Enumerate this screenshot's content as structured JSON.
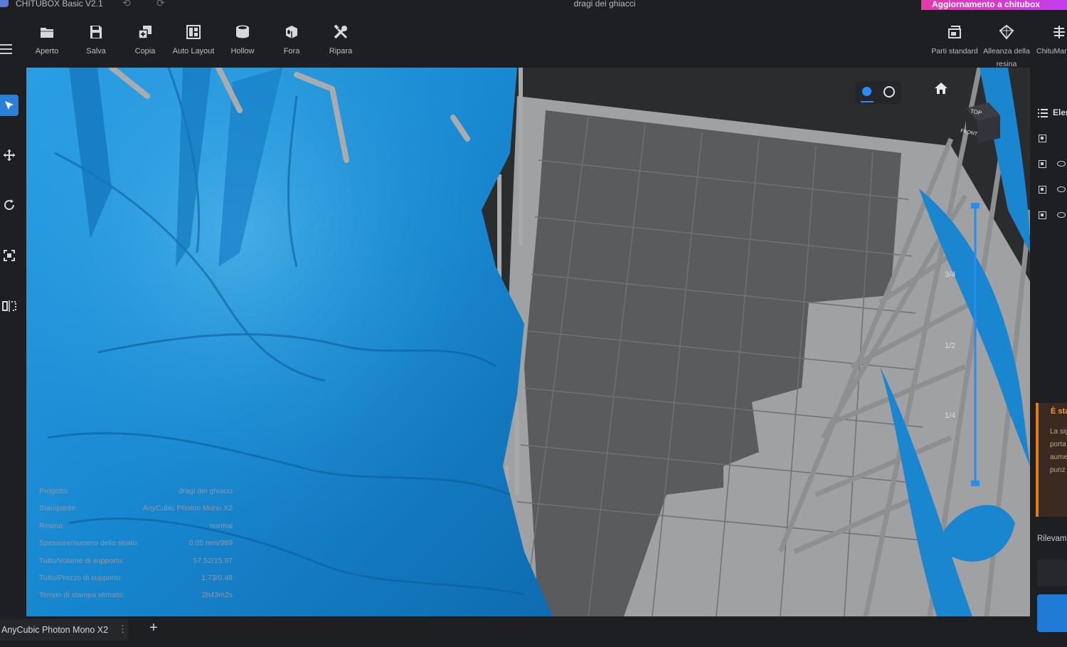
{
  "titlebar": {
    "app_title": "CHITUBOX Basic V2.1",
    "document_title": "dragi dei ghiacci",
    "update_banner": "Aggiornamento a chitubox"
  },
  "toolbar": {
    "tools": [
      {
        "label": "Aperto",
        "icon": "folder-icon"
      },
      {
        "label": "Salva",
        "icon": "save-icon"
      },
      {
        "label": "Copia",
        "icon": "copy-icon"
      },
      {
        "label": "Auto Layout",
        "icon": "auto-layout-icon"
      },
      {
        "label": "Hollow",
        "icon": "hollow-icon"
      },
      {
        "label": "Fora",
        "icon": "drill-icon"
      },
      {
        "label": "Ripara",
        "icon": "repair-icon"
      }
    ],
    "right_tools": [
      {
        "label": "Parti standard",
        "icon": "standard-parts-icon"
      },
      {
        "label": "Alleanza della resina",
        "icon": "resin-alliance-icon"
      },
      {
        "label": "ChituMar",
        "icon": "chitumarket-icon"
      }
    ]
  },
  "left_tools": [
    "select-icon",
    "move-icon",
    "rotate-icon",
    "scale-icon",
    "mirror-icon"
  ],
  "view_cube": {
    "top": "TOP",
    "front": "FRONT"
  },
  "slider": {
    "three_quarter": "3/4",
    "half": "1/2",
    "quarter": "1/4"
  },
  "info": [
    {
      "label": "Progetto:",
      "value": "dragi dei ghiacci"
    },
    {
      "label": "Stampante:",
      "value": "AnyCubic Photon Mono X2"
    },
    {
      "label": "Resina:",
      "value": "normal"
    },
    {
      "label": "Spessore/numero dello strato:",
      "value": "0.05 mm/989"
    },
    {
      "label": "Tutto/Volume di supporto:",
      "value": "57.52/15.97"
    },
    {
      "label": "Tutto/Prezzo di supporto:",
      "value": "1.73/0.48"
    },
    {
      "label": "Tempo di stampa stimato:",
      "value": "2h43m2s"
    }
  ],
  "right_panel": {
    "header": "Elenco",
    "notice_title": "È stata",
    "notice_lines": [
      "La sig",
      "porta",
      "aume",
      "punz"
    ],
    "detect_label": "Rilevamento"
  },
  "bottom": {
    "printer_tab": "AnyCubic Photon Mono X2",
    "add_tab": "+"
  },
  "colors": {
    "accent": "#2a8cf0",
    "model": "#1a86cf",
    "support": "#9a9b9d",
    "plate": "#5a5b5d",
    "banner": "#e63aa8",
    "notice": "#e57a12"
  }
}
